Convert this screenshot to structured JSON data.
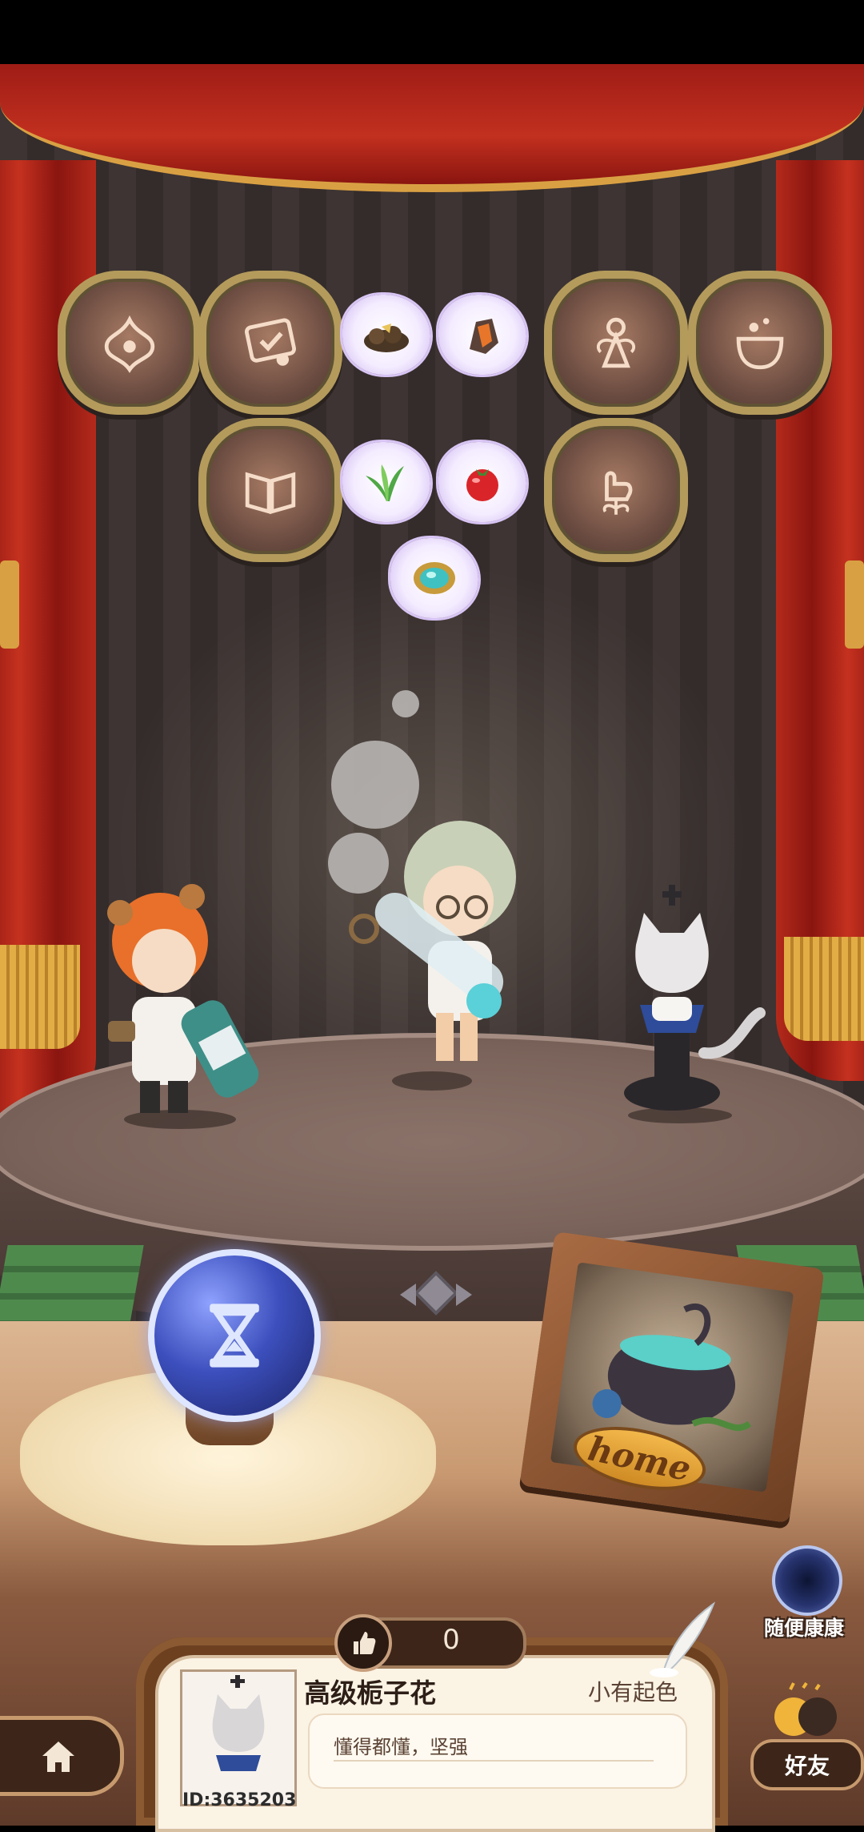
{
  "stage": {
    "medals": [
      {
        "name": "flower-ornament-medal",
        "icon": "flower-ornament-icon"
      },
      {
        "name": "certificate-medal",
        "icon": "certificate-icon"
      },
      {
        "name": "fairy-medal",
        "icon": "fairy-icon"
      },
      {
        "name": "cauldron-medal",
        "icon": "cauldron-icon"
      },
      {
        "name": "book-medal",
        "icon": "book-icon"
      },
      {
        "name": "thumb-flower-medal",
        "icon": "thumb-flower-icon"
      }
    ],
    "items": [
      {
        "name": "ore-item",
        "icon": "ore-icon"
      },
      {
        "name": "amber-crystal-item",
        "icon": "amber-crystal-icon"
      },
      {
        "name": "herb-item",
        "icon": "herb-icon"
      },
      {
        "name": "tomato-item",
        "icon": "tomato-icon"
      },
      {
        "name": "gem-ring-item",
        "icon": "gem-ring-icon"
      }
    ],
    "characters": [
      "lion-alchemist",
      "potion-girl",
      "cat-on-chess-piece"
    ]
  },
  "home_frame": {
    "label": "home"
  },
  "random_visit": {
    "label": "随便康康",
    "icon": "portal-icon"
  },
  "likes": {
    "count": "0",
    "icon": "thumbs-up-icon"
  },
  "player": {
    "name": "高级栀子花",
    "title": "小有起色",
    "motto": "懂得都懂，坚强",
    "id": "ID:3635203"
  },
  "nav": {
    "home_icon": "house-icon"
  },
  "friends": {
    "label": "好友"
  },
  "colors": {
    "curtain": "#c2301f",
    "gold": "#d9a043",
    "wood": "#6d4020",
    "paper": "#fbf3e4"
  }
}
